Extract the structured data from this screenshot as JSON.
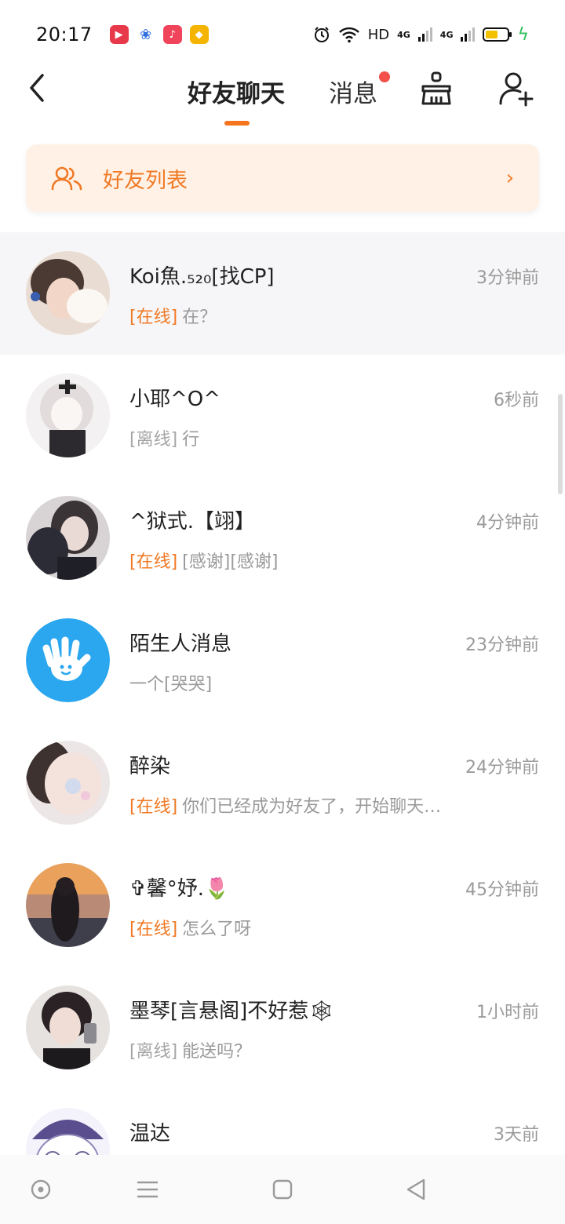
{
  "status_bar": {
    "time": "20:17",
    "network": "HD",
    "signal1": "4G",
    "signal2": "4G"
  },
  "header": {
    "tab_friends": "好友聊天",
    "tab_messages": "消息"
  },
  "friend_list_banner": {
    "label": "好友列表"
  },
  "chats": [
    {
      "name": "Koi魚.₅₂₀[找CP]",
      "time": "3分钟前",
      "status": "[在线]",
      "preview": "在？",
      "online": true
    },
    {
      "name": "小耶^O^",
      "time": "6秒前",
      "status": "[离线]",
      "preview": "行",
      "online": false
    },
    {
      "name": "^狱式.【翊】",
      "time": "4分钟前",
      "status": "[在线]",
      "preview": "[感谢][感谢]",
      "online": true
    },
    {
      "name": "陌生人消息",
      "time": "23分钟前",
      "status": "",
      "preview": "一个[哭哭]",
      "online": false
    },
    {
      "name": "醉染",
      "time": "24分钟前",
      "status": "[在线]",
      "preview": "你们已经成为好友了，开始聊天…",
      "online": true
    },
    {
      "name": "✞馨°妤.🌷",
      "time": "45分钟前",
      "status": "[在线]",
      "preview": "怎么了呀",
      "online": true
    },
    {
      "name": "墨琴[言悬阁]不好惹🕸",
      "time": "1小时前",
      "status": "[离线]",
      "preview": "能送吗？",
      "online": false
    },
    {
      "name": "温达",
      "time": "3天前",
      "status": "",
      "preview": "",
      "online": false
    }
  ],
  "colors": {
    "accent": "#f07a26",
    "online": "#f07a26",
    "offline": "#a6a6a6",
    "banner_bg": "#fff1e6",
    "badge": "#f4504b"
  }
}
